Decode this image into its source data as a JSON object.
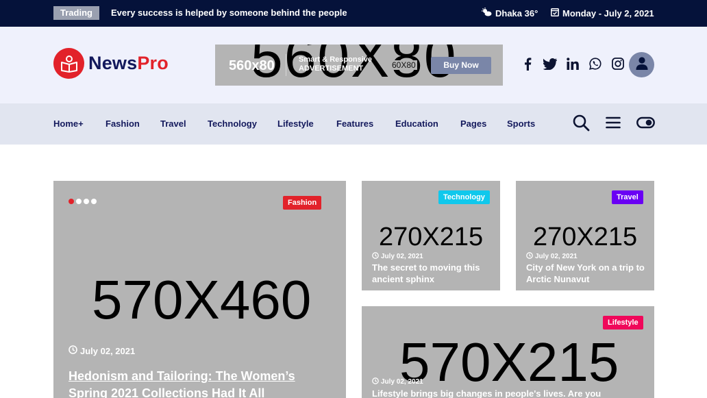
{
  "topbar": {
    "trading_label": "Trading",
    "ticker_text": "Every success is helped by someone behind the people",
    "weather_text": "Dhaka 36°",
    "date_text": "Monday - July 2, 2021"
  },
  "header": {
    "logo_part1": "News",
    "logo_part2": "Pro",
    "ad": {
      "size_label": "560x80",
      "tag_line1": "Smart & Responsive",
      "tag_line2": "ADVERTISEMENT",
      "placeholder": "560X80",
      "small_size": "60X80",
      "button": "Buy Now"
    },
    "socials": [
      "facebook-icon",
      "twitter-icon",
      "linkedin-icon",
      "whatsapp-icon",
      "instagram-icon"
    ]
  },
  "nav": {
    "items": [
      "Home+",
      "Fashion",
      "Travel",
      "Technology",
      "Lifestyle",
      "Features",
      "Education",
      "Pages",
      "Sports"
    ]
  },
  "colors": {
    "topbar": "#05123a",
    "brand_red": "#e2222a",
    "brand_navy": "#13195c",
    "fashion": "#e2222a",
    "technology": "#10c8ec",
    "travel": "#6a00f4",
    "lifestyle": "#f0075a"
  },
  "main_card": {
    "placeholder": "570X460",
    "category": "Fashion",
    "date": "July 02, 2021",
    "title": "Hedonism and Tailoring: The Women’s Spring 2021 Collections Had It All",
    "slider_dots": 4,
    "active_dot": 1
  },
  "card_tech": {
    "placeholder": "270X215",
    "category": "Technology",
    "date": "July 02, 2021",
    "title": "The secret to moving this ancient sphinx"
  },
  "card_travel": {
    "placeholder": "270X215",
    "category": "Travel",
    "date": "July 02, 2021",
    "title": "City of New York on a trip to Arctic Nunavut"
  },
  "card_lifestyle": {
    "placeholder": "570X215",
    "category": "Lifestyle",
    "date": "July 02, 2021",
    "title": "Lifestyle brings big changes in people's lives. Are you"
  }
}
